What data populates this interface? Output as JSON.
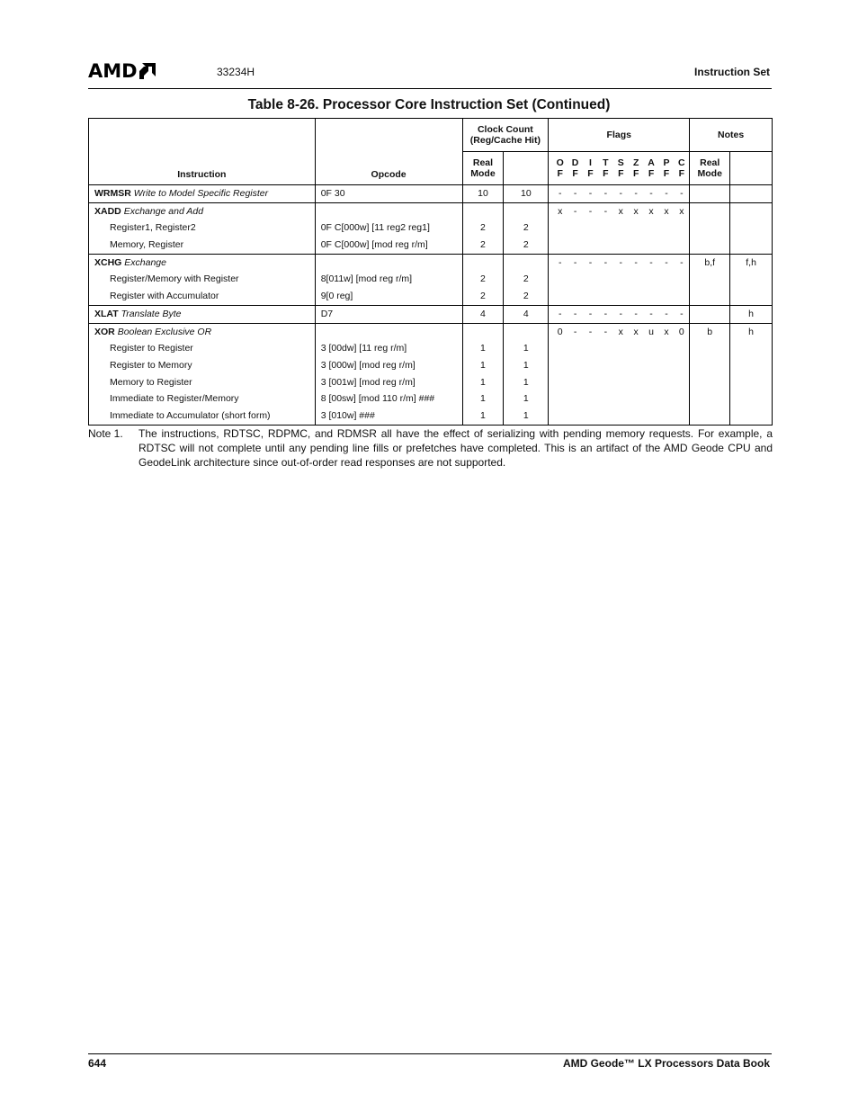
{
  "header": {
    "logo_text": "AMD",
    "logo_icon": "amd-arrow-logo-icon",
    "doc_number": "33234H",
    "section": "Instruction Set"
  },
  "table": {
    "title": "Table 8-26.  Processor Core Instruction Set  (Continued)",
    "headers": {
      "instruction": "Instruction",
      "opcode": "Opcode",
      "clock_count": "Clock Count (Reg/Cache Hit)",
      "clock_real_mode": "Real Mode",
      "flags": "Flags",
      "notes": "Notes",
      "notes_real_mode": "Real Mode",
      "flag_names": [
        {
          "top": "O",
          "bottom": "F"
        },
        {
          "top": "D",
          "bottom": "F"
        },
        {
          "top": "I",
          "bottom": "F"
        },
        {
          "top": "T",
          "bottom": "F"
        },
        {
          "top": "S",
          "bottom": "F"
        },
        {
          "top": "Z",
          "bottom": "F"
        },
        {
          "top": "A",
          "bottom": "F"
        },
        {
          "top": "P",
          "bottom": "F"
        },
        {
          "top": "C",
          "bottom": "F"
        }
      ]
    },
    "groups": [
      {
        "mnemonic": "WRMSR",
        "description": "Write to Model Specific Register",
        "opcode": "0F 30",
        "clk_real": "10",
        "clk_prot": "10",
        "flags": [
          "-",
          "-",
          "-",
          "-",
          "-",
          "-",
          "-",
          "-",
          "-"
        ],
        "note_real": "",
        "note_prot": "",
        "forms": []
      },
      {
        "mnemonic": "XADD",
        "description": "Exchange and Add",
        "opcode": "",
        "clk_real": "",
        "clk_prot": "",
        "flags": [
          "x",
          "-",
          "-",
          "-",
          "x",
          "x",
          "x",
          "x",
          "x"
        ],
        "note_real": "",
        "note_prot": "",
        "forms": [
          {
            "name": "Register1, Register2",
            "opcode": "0F C[000w] [11 reg2 reg1]",
            "clk_real": "2",
            "clk_prot": "2"
          },
          {
            "name": "Memory, Register",
            "opcode": "0F C[000w] [mod reg r/m]",
            "clk_real": "2",
            "clk_prot": "2"
          }
        ]
      },
      {
        "mnemonic": "XCHG",
        "description": "Exchange",
        "opcode": "",
        "clk_real": "",
        "clk_prot": "",
        "flags": [
          "-",
          "-",
          "-",
          "-",
          "-",
          "-",
          "-",
          "-",
          "-"
        ],
        "note_real": "b,f",
        "note_prot": "f,h",
        "forms": [
          {
            "name": "Register/Memory with Register",
            "opcode": "8[011w] [mod reg r/m]",
            "clk_real": "2",
            "clk_prot": "2"
          },
          {
            "name": "Register with Accumulator",
            "opcode": "9[0 reg]",
            "clk_real": "2",
            "clk_prot": "2"
          }
        ]
      },
      {
        "mnemonic": "XLAT",
        "description": "Translate Byte",
        "opcode": "D7",
        "clk_real": "4",
        "clk_prot": "4",
        "flags": [
          "-",
          "-",
          "-",
          "-",
          "-",
          "-",
          "-",
          "-",
          "-"
        ],
        "note_real": "",
        "note_prot": "h",
        "forms": []
      },
      {
        "mnemonic": "XOR",
        "description": "Boolean Exclusive OR",
        "opcode": "",
        "clk_real": "",
        "clk_prot": "",
        "flags": [
          "0",
          "-",
          "-",
          "-",
          "x",
          "x",
          "u",
          "x",
          "0"
        ],
        "note_real": "b",
        "note_prot": "h",
        "forms": [
          {
            "name": "Register to Register",
            "opcode": "3 [00dw] [11 reg r/m]",
            "clk_real": "1",
            "clk_prot": "1"
          },
          {
            "name": "Register to Memory",
            "opcode": "3 [000w] [mod reg r/m]",
            "clk_real": "1",
            "clk_prot": "1"
          },
          {
            "name": "Memory to Register",
            "opcode": "3 [001w] [mod reg r/m]",
            "clk_real": "1",
            "clk_prot": "1"
          },
          {
            "name": "Immediate to Register/Memory",
            "opcode": "8 [00sw] [mod 110 r/m] ###",
            "clk_real": "1",
            "clk_prot": "1"
          },
          {
            "name": "Immediate to Accumulator (short form)",
            "opcode": "3 [010w] ###",
            "clk_real": "1",
            "clk_prot": "1"
          }
        ]
      }
    ]
  },
  "note": {
    "label": "Note 1.",
    "text": "The instructions, RDTSC, RDPMC, and RDMSR all have the effect of serializing with pending memory requests. For example, a RDTSC will not complete until any pending line fills or prefetches have completed. This is an artifact of the AMD Geode CPU and GeodeLink architecture since out-of-order read responses are not supported."
  },
  "footer": {
    "page_number": "644",
    "book_title": "AMD Geode™ LX Processors Data Book"
  }
}
